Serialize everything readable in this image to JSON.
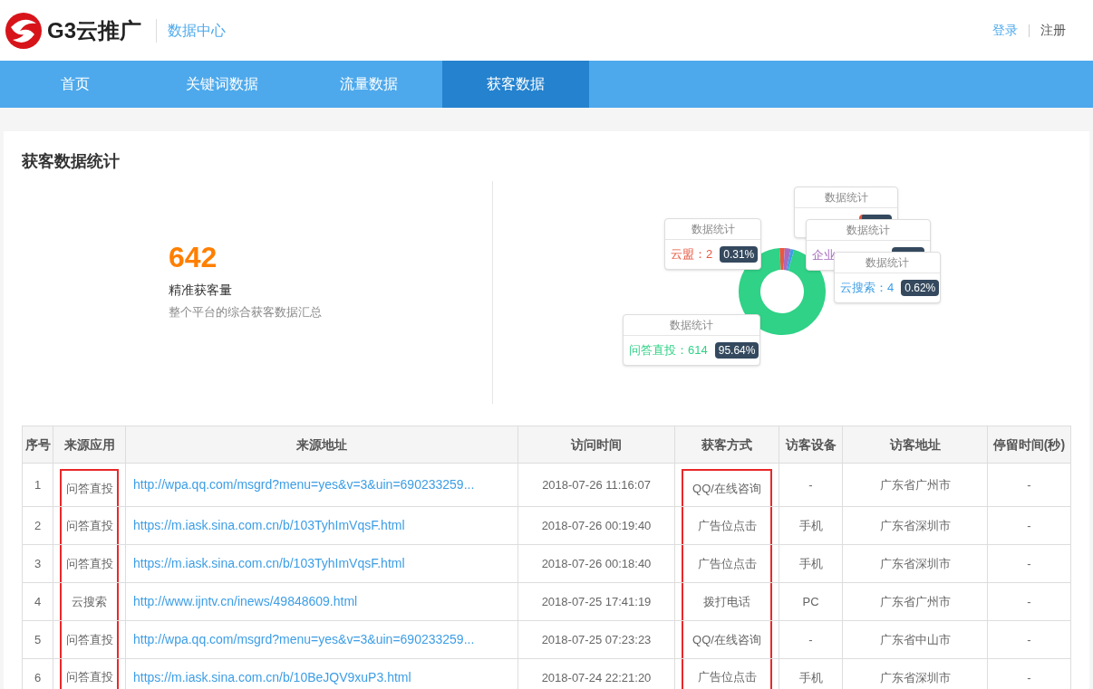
{
  "header": {
    "logo_text": "G3云推广",
    "section": "数据中心",
    "login": "登录",
    "register": "注册"
  },
  "nav": [
    {
      "label": "首页",
      "selected": false
    },
    {
      "label": "关键词数据",
      "selected": false
    },
    {
      "label": "流量数据",
      "selected": false
    },
    {
      "label": "获客数据",
      "selected": true
    }
  ],
  "panel": {
    "title": "获客数据统计",
    "total": "642",
    "total_label": "精准获客量",
    "total_desc": "整个平台的综合获客数据汇总"
  },
  "tooltips": [
    {
      "title": "数据统计",
      "label": "云盟：2",
      "percent": "0.31%",
      "color": "#e9573f"
    },
    {
      "title": "数据统计",
      "color": "#e9573f"
    },
    {
      "title": "数据统计",
      "label": "企业",
      "color": "#a66bbe"
    },
    {
      "title": "数据统计",
      "label": "云搜索：4",
      "percent": "0.62%",
      "color": "#3d9ee6"
    },
    {
      "title": "数据统计",
      "label": "问答直投：614",
      "percent": "95.64%",
      "color": "#2fd286"
    }
  ],
  "table": {
    "columns": [
      {
        "label": "序号",
        "highlighted": false
      },
      {
        "label": "来源应用",
        "highlighted": true
      },
      {
        "label": "来源地址",
        "highlighted": false
      },
      {
        "label": "访问时间",
        "highlighted": false
      },
      {
        "label": "获客方式",
        "highlighted": true
      },
      {
        "label": "访客设备",
        "highlighted": false
      },
      {
        "label": "访客地址",
        "highlighted": false
      },
      {
        "label": "停留时间(秒)",
        "highlighted": false
      }
    ],
    "rows": [
      [
        "1",
        "问答直投",
        "http://wpa.qq.com/msgrd?menu=yes&v=3&uin=690233259...",
        "2018-07-26 11:16:07",
        "QQ/在线咨询",
        "-",
        "广东省广州市",
        "-"
      ],
      [
        "2",
        "问答直投",
        "https://m.iask.sina.com.cn/b/103TyhImVqsF.html",
        "2018-07-26 00:19:40",
        "广告位点击",
        "手机",
        "广东省深圳市",
        "-"
      ],
      [
        "3",
        "问答直投",
        "https://m.iask.sina.com.cn/b/103TyhImVqsF.html",
        "2018-07-26 00:18:40",
        "广告位点击",
        "手机",
        "广东省深圳市",
        "-"
      ],
      [
        "4",
        "云搜索",
        "http://www.ijntv.cn/inews/49848609.html",
        "2018-07-25 17:41:19",
        "拨打电话",
        "PC",
        "广东省广州市",
        "-"
      ],
      [
        "5",
        "问答直投",
        "http://wpa.qq.com/msgrd?menu=yes&v=3&uin=690233259...",
        "2018-07-25 07:23:23",
        "QQ/在线咨询",
        "-",
        "广东省中山市",
        "-"
      ],
      [
        "6",
        "问答直投",
        "https://m.iask.sina.com.cn/b/10BeJQV9xuP3.html",
        "2018-07-24 22:21:20",
        "广告位点击",
        "手机",
        "广东省深圳市",
        "-"
      ]
    ]
  }
}
